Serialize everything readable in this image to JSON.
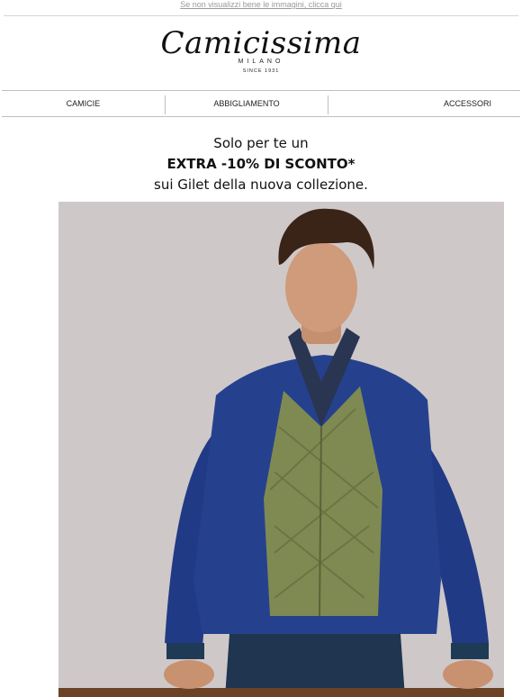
{
  "preheader": {
    "link_text": "Se non visualizzi bene le immagini, clicca qui"
  },
  "brand": {
    "name": "Camicissima",
    "city": "MILANO",
    "since": "SINCE 1931"
  },
  "nav": {
    "items": [
      "CAMICIE",
      "ABBIGLIAMENTO",
      "ACCESSORI"
    ]
  },
  "promo": {
    "line1": "Solo per te un",
    "line2": "EXTRA -10% DI SCONTO*",
    "line3": "sui Gilet della nuova collezione."
  },
  "colors": {
    "photo_background": "#cfc8c8",
    "jacket": "#243f8a",
    "gilet": "#7f8a52"
  }
}
